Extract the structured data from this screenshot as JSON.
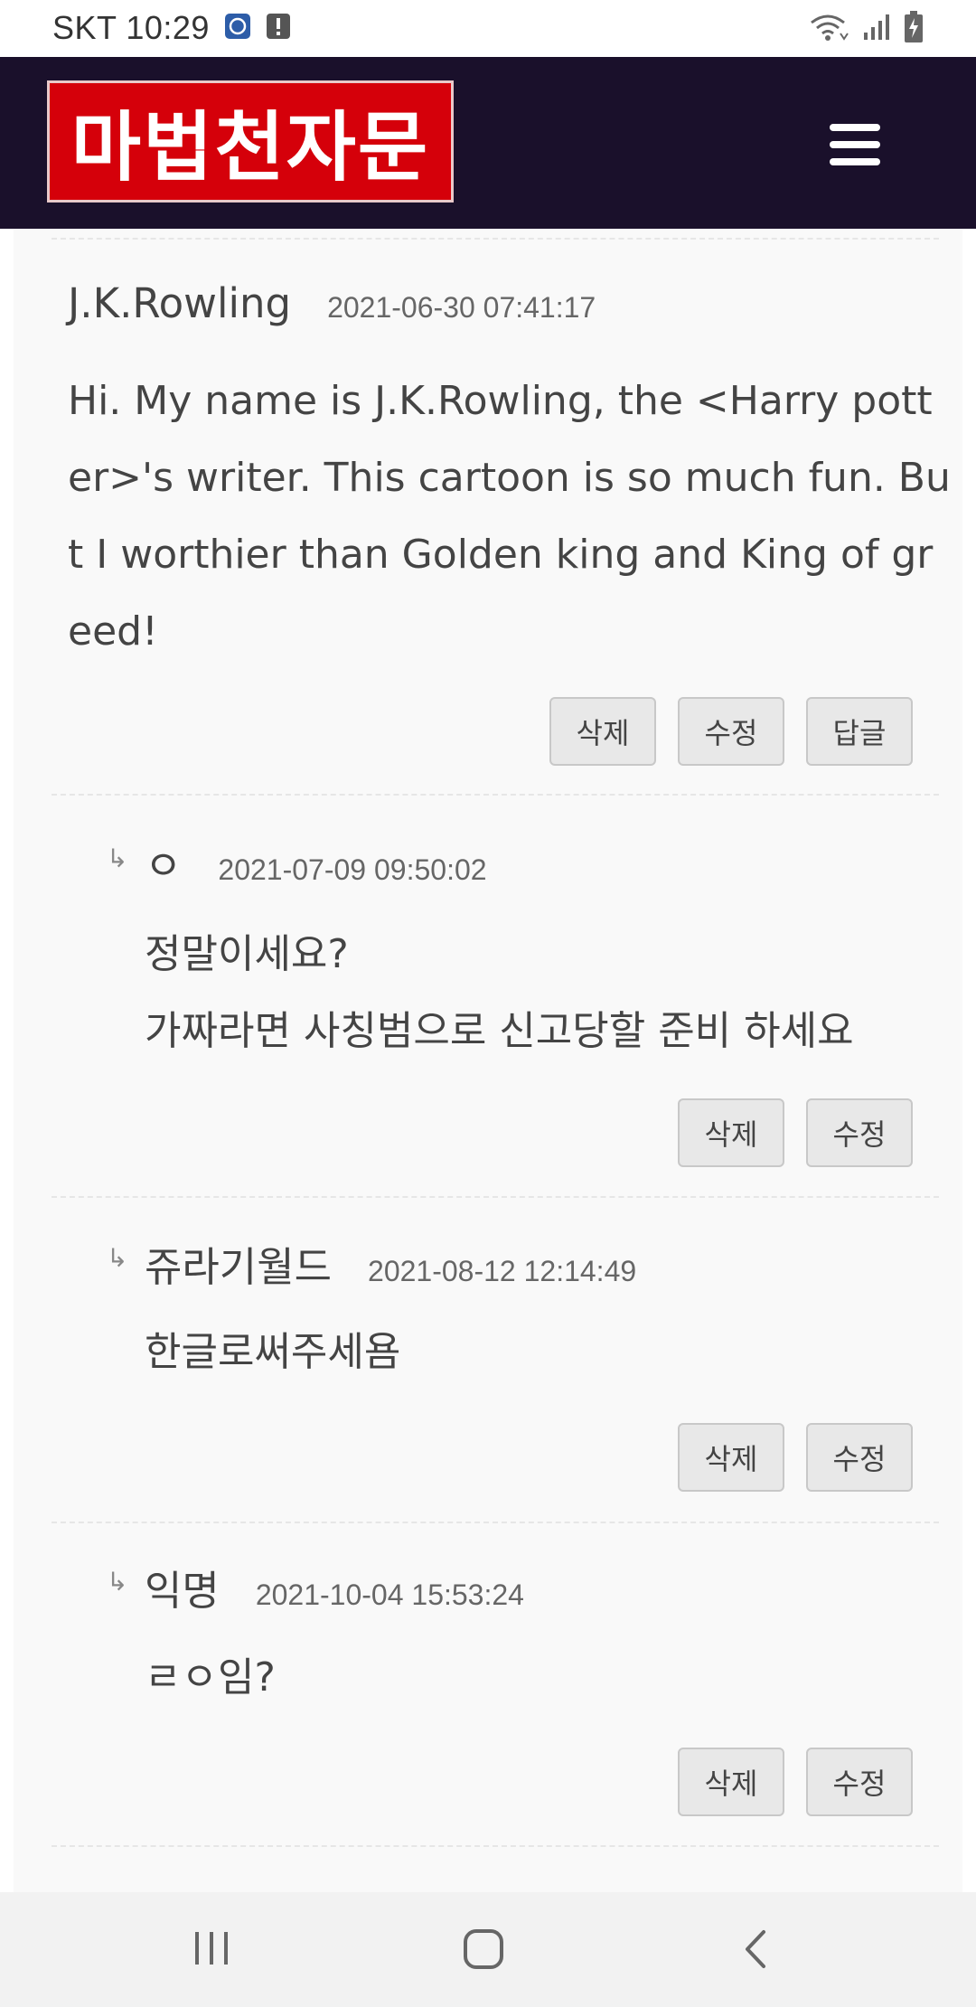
{
  "status_bar": {
    "carrier_time": "SKT 10:29",
    "icons": [
      "app-notification-icon",
      "alert-icon",
      "wifi-icon",
      "signal-icon",
      "battery-charging-icon"
    ]
  },
  "header": {
    "logo_text": "마법천자문",
    "menu_icon": "hamburger-menu-icon",
    "brand_color": "#d5000a",
    "bar_color": "#1a102b"
  },
  "comments": [
    {
      "author": "J.K.Rowling",
      "date": "2021-06-30 07:41:17",
      "lines": [
        "Hi. My name is J.K.Rowling, the <Harry pott",
        "er>'s writer. This cartoon is so much fun. Bu",
        "t I worthier than Golden king and King of gr",
        "eed!"
      ],
      "buttons": {
        "delete": "삭제",
        "edit": "수정",
        "reply": "답글"
      }
    },
    {
      "reply_marker": "↳",
      "author": "ㅇ",
      "date": "2021-07-09 09:50:02",
      "lines": [
        "정말이세요?",
        "가짜라면 사칭범으로 신고당할 준비 하세요"
      ],
      "buttons": {
        "delete": "삭제",
        "edit": "수정"
      }
    },
    {
      "reply_marker": "↳",
      "author": "쥬라기월드",
      "date": "2021-08-12 12:14:49",
      "lines": [
        "한글로써주세욤"
      ],
      "buttons": {
        "delete": "삭제",
        "edit": "수정"
      }
    },
    {
      "reply_marker": "↳",
      "author": "익명",
      "date": "2021-10-04 15:53:24",
      "lines": [
        "ㄹㅇ임?"
      ],
      "buttons": {
        "delete": "삭제",
        "edit": "수정"
      }
    }
  ],
  "nav_bar": {
    "icons": [
      "recent-apps-icon",
      "home-icon",
      "back-icon"
    ]
  }
}
